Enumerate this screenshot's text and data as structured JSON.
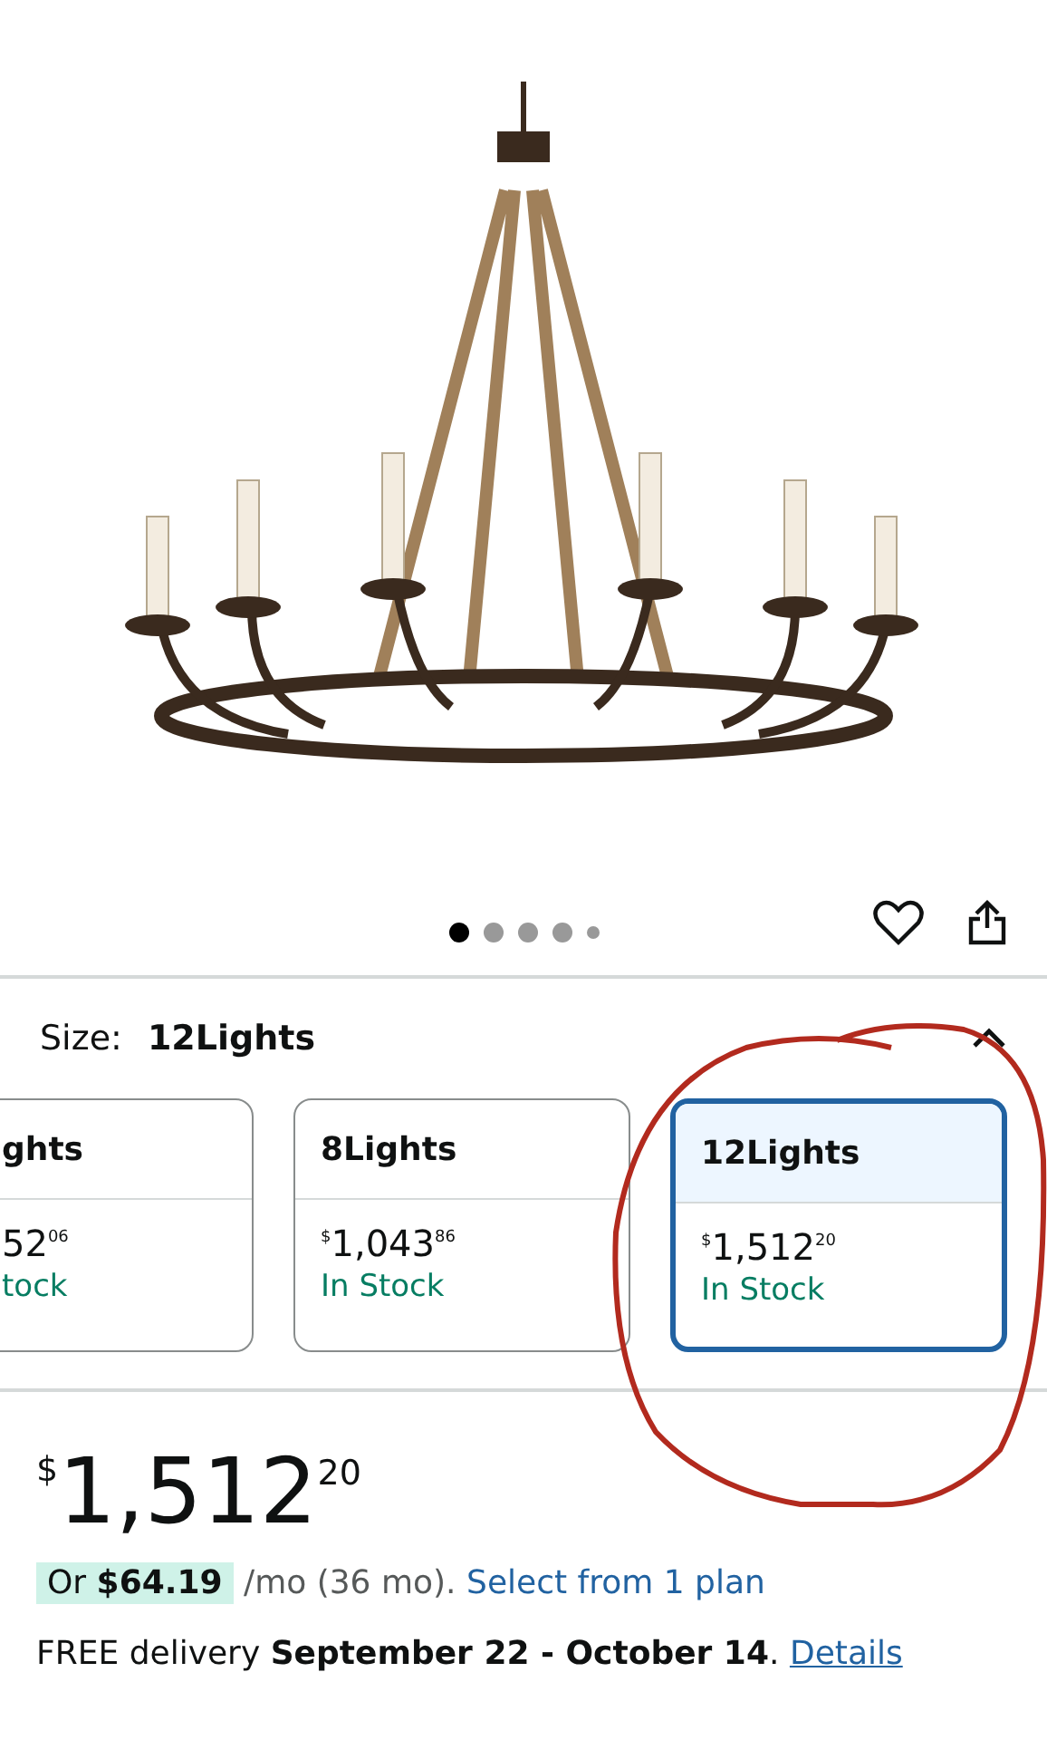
{
  "gallery": {
    "dots": [
      {
        "selected": true
      },
      {
        "selected": false
      },
      {
        "selected": false
      },
      {
        "selected": false
      },
      {
        "selected": false
      }
    ]
  },
  "size": {
    "label": "Size:",
    "value": "12Lights",
    "expanded": true
  },
  "options": [
    {
      "name": "ghts",
      "whole": "52",
      "fraction": "06",
      "stock": "tock",
      "selected": false
    },
    {
      "name": "8Lights",
      "currency": "$",
      "whole": "1,043",
      "fraction": "86",
      "stock": "In Stock",
      "selected": false
    },
    {
      "name": "12Lights",
      "currency": "$",
      "whole": "1,512",
      "fraction": "20",
      "stock": "In Stock",
      "selected": true
    }
  ],
  "price": {
    "currency": "$",
    "whole": "1,512",
    "fraction": "20"
  },
  "financing": {
    "offer": "Or **$64.19**",
    "terms": "/mo (36 mo).",
    "link": "Select from 1 plan"
  },
  "delivery": {
    "text": "FREE delivery **September 22 - October 14**.",
    "link": "Details"
  }
}
